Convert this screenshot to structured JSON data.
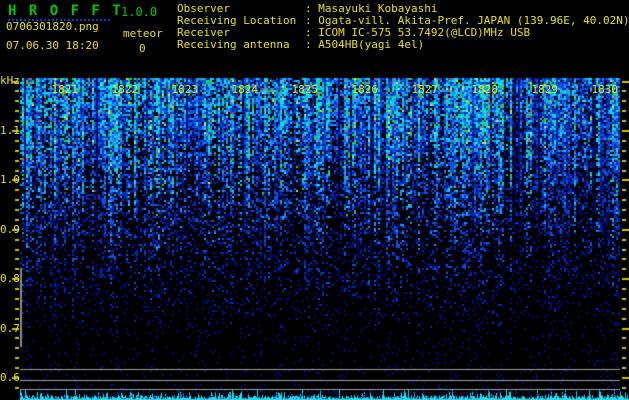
{
  "colors": {
    "background": "#000000",
    "title_green": "#00c600",
    "text_yellow": "#e8e400",
    "tick_yellow": "#d2c200",
    "gray_line": "#a0a0a0",
    "marker_gray": "#8c8c8c",
    "trace_cyan": "#28dcee",
    "underline_blue": "#2230cc"
  },
  "header": {
    "app_title": "H R O F F T",
    "version": "1.0.0",
    "filename": "0706301820.png",
    "meteor_label": "meteor",
    "meteor_count": "0",
    "datetime": "07.06.30 18:20",
    "info_lines": [
      {
        "label": "Observer",
        "value": ": Masayuki Kobayashi"
      },
      {
        "label": "Receiving Location",
        "value": ": Ogata-vill. Akita-Pref. JAPAN (139.96E, 40.02N)"
      },
      {
        "label": "Receiver",
        "value": ": ICOM IC-575 53.7492(@LCD)MHz USB"
      },
      {
        "label": "Receiving antenna",
        "value": ": A504HB(yagi 4el)"
      }
    ]
  },
  "axis": {
    "unit_label": "kHz",
    "y_ticks": [
      {
        "label": "1.1",
        "freq": 1.1
      },
      {
        "label": "1.0",
        "freq": 1.0
      },
      {
        "label": "0.9",
        "freq": 0.9
      },
      {
        "label": "0.8",
        "freq": 0.8
      },
      {
        "label": "0.7",
        "freq": 0.7
      },
      {
        "label": "0.6",
        "freq": 0.6
      }
    ],
    "time_labels": [
      {
        "label": "1821",
        "minute": 1
      },
      {
        "label": "1822",
        "minute": 2
      },
      {
        "label": "1823",
        "minute": 3
      },
      {
        "label": "1824",
        "minute": 4
      },
      {
        "label": "1825",
        "minute": 5
      },
      {
        "label": "1826",
        "minute": 6
      },
      {
        "label": "1827",
        "minute": 7
      },
      {
        "label": "1828",
        "minute": 8
      },
      {
        "label": "1829",
        "minute": 9
      },
      {
        "label": "1830",
        "minute": 10
      }
    ]
  },
  "chart_data": {
    "type": "heatmap",
    "title": "HROFFT 10-minute radio meteor spectrogram 18:21-18:30",
    "x_tick_labels": [
      "1821",
      "1822",
      "1823",
      "1824",
      "1825",
      "1826",
      "1827",
      "1828",
      "1829",
      "1830"
    ],
    "x_span_seconds": 600,
    "ylabel": "kHz",
    "y_tick_labels": [
      "1.1",
      "1.0",
      "0.9",
      "0.8",
      "0.7",
      "0.6"
    ],
    "ylim": [
      0.58,
      1.21
    ],
    "y_minor_tick_step_khz": 0.02,
    "meteor_count": 0,
    "intensity_profile": [
      {
        "freq_khz": [
          1.0,
          1.21
        ],
        "relative_intensity": 0.95,
        "appearance": "dense bright blue-cyan-green speckle with vertical streaks"
      },
      {
        "freq_khz": [
          0.85,
          1.0
        ],
        "relative_intensity": 0.6,
        "appearance": "moderate blue speckle"
      },
      {
        "freq_khz": [
          0.7,
          0.85
        ],
        "relative_intensity": 0.25,
        "appearance": "sparse dark-blue speckle"
      },
      {
        "freq_khz": [
          0.58,
          0.7
        ],
        "relative_intensity": 0.07,
        "appearance": "near-black with sparse blue dots"
      }
    ],
    "horizontal_reference_lines_khz": [
      0.616,
      0.594,
      0.576
    ],
    "echo_band_marker_khz": [
      0.66,
      0.82
    ],
    "bottom_trace": "jagged cyan signal-level trace along bottom edge",
    "grid": false,
    "legend": false
  }
}
